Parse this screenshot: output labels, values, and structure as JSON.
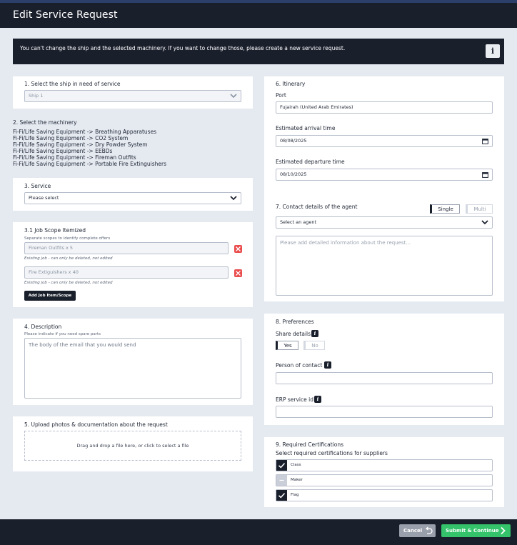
{
  "window": {
    "title": "Edit Service Request"
  },
  "notice": {
    "text": "You can't change the ship and the selected machinery. If you want to change those, please create a new service request.",
    "info_icon": "i"
  },
  "ship": {
    "label": "1. Select the ship in need of service",
    "value": "Ship 1"
  },
  "machinery": {
    "label": "2. Select the machinery",
    "items": [
      "Fi-Fi/Life Saving Equipment -> Breathing Apparatuses",
      "Fi-Fi/Life Saving Equipment -> CO2 System",
      "Fi-Fi/Life Saving Equipment -> Dry Powder System",
      "Fi-Fi/Life Saving Equipment -> EEBDs",
      "Fi-Fi/Life Saving Equipment -> Fireman Outfits",
      "Fi-Fi/Life Saving Equipment -> Portable Fire Extinguishers"
    ]
  },
  "service": {
    "label": "3. Service",
    "value": "Please select"
  },
  "job_scope": {
    "label": "3.1 Job Scope Itemized",
    "sublabel": "Separate scopes to identify complete offers",
    "items": [
      {
        "value": "Fireman Outfits x 5",
        "note": "Existing job - can only be deleted, not edited"
      },
      {
        "value": "Fire Extiguishers x 40",
        "note": "Existing job - can only be deleted, not edited"
      }
    ],
    "add_button": "Add Job Item/Scope"
  },
  "description": {
    "label": "4. Description",
    "sublabel": "Please indicate if you need spare parts",
    "placeholder": "The body of the email that you would send"
  },
  "upload": {
    "label": "5. Upload photos & documentation about the request",
    "dropzone": "Drag and drop a file here, or click to select a file"
  },
  "itinerary": {
    "label": "6. Itinerary",
    "port_label": "Port",
    "port_value": "Fujairah (United Arab Emirates)",
    "arrival_label": "Estimated arrival time",
    "arrival_value": "08/08/2025",
    "departure_label": "Estimated departure time",
    "departure_value": "08/10/2025"
  },
  "agent": {
    "label": "7. Contact details of the agent",
    "toggle_single": "Single",
    "toggle_multi": "Multi",
    "select_value": "Select an agent",
    "placeholder": "Please add detailed information about the request..."
  },
  "preferences": {
    "label": "8. Preferences",
    "share_label": "Share details",
    "yes": "Yes",
    "no": "No",
    "person_label": "Person of contact",
    "erp_label": "ERP service id"
  },
  "certifications": {
    "label": "9. Required Certifications",
    "sublabel": "Select required certifications for suppliers",
    "items": [
      {
        "name": "Class",
        "checked": true
      },
      {
        "name": "Maker",
        "checked": false
      },
      {
        "name": "Flag",
        "checked": true
      }
    ]
  },
  "footer": {
    "cancel": "Cancel",
    "submit": "Submit & Continue"
  },
  "colors": {
    "dark": "#1a1f2c",
    "submit": "#34c36b",
    "cancel": "#9aa0ab",
    "delete": "#ea4d4d",
    "background": "#e5eaf1"
  }
}
